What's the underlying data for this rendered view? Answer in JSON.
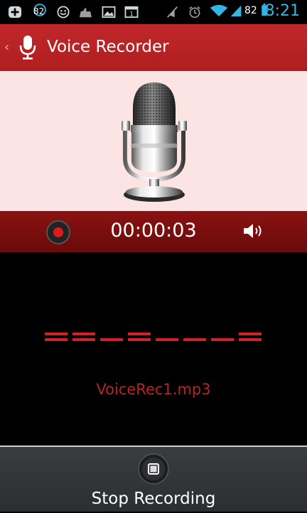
{
  "status_bar": {
    "notification_badge": "82",
    "battery_percent": "82",
    "time": "8:21",
    "icons": [
      "add-icon",
      "badge-icon",
      "smiley-icon",
      "android-icon",
      "image-icon",
      "calendar-icon",
      "mute-icon",
      "alarm-icon",
      "wifi-icon",
      "signal-icon",
      "battery-icon"
    ]
  },
  "action_bar": {
    "title": "Voice Recorder",
    "back_glyph": "‹"
  },
  "recorder": {
    "elapsed_time": "00:00:03",
    "record_indicator_color": "#e0191f",
    "filename": "VoiceRec1.mp3"
  },
  "level_meter": {
    "segments": [
      "double",
      "double",
      "single",
      "double",
      "single",
      "single",
      "single",
      "double"
    ],
    "color": "#d32025"
  },
  "bottom": {
    "stop_label": "Stop Recording"
  }
}
